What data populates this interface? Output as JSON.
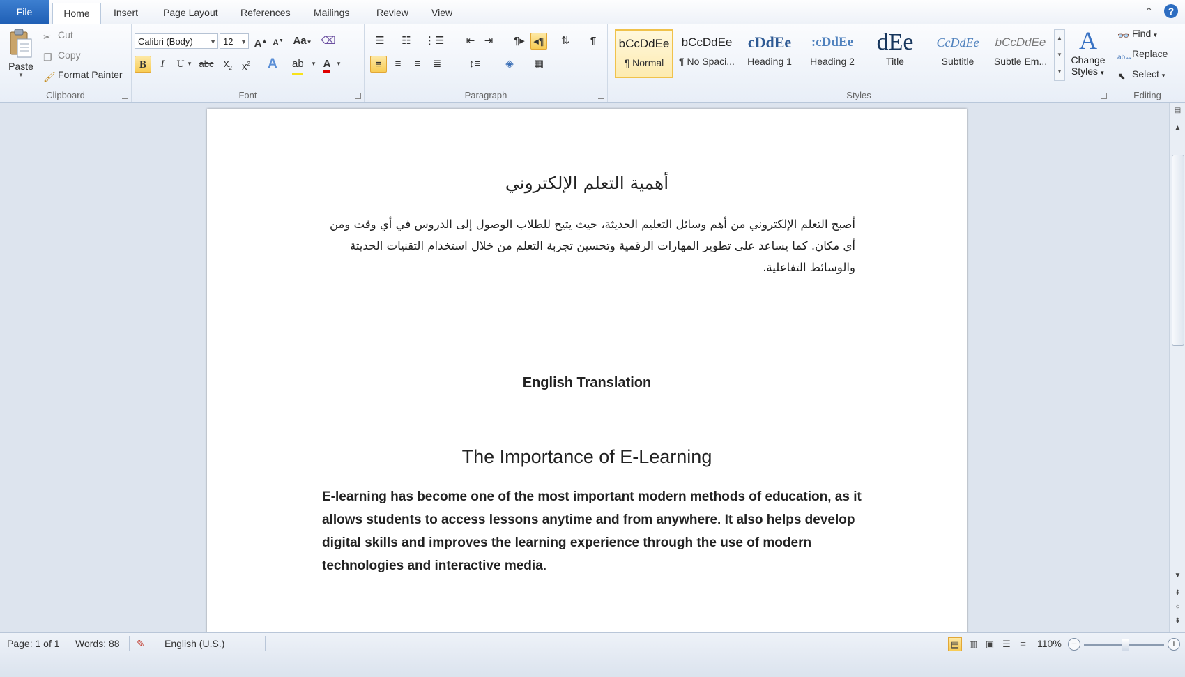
{
  "tabs": {
    "file": "File",
    "home": "Home",
    "insert": "Insert",
    "page_layout": "Page Layout",
    "references": "References",
    "mailings": "Mailings",
    "review": "Review",
    "view": "View"
  },
  "clipboard": {
    "paste": "Paste",
    "cut": "Cut",
    "copy": "Copy",
    "format_painter": "Format Painter",
    "label": "Clipboard"
  },
  "font": {
    "name": "Calibri (Body)",
    "size": "12",
    "bold": "B",
    "italic": "I",
    "underline": "U",
    "strike": "abc",
    "label": "Font"
  },
  "paragraph": {
    "label": "Paragraph"
  },
  "styles": {
    "label": "Styles",
    "items": [
      {
        "preview": "bCcDdEe",
        "name": "¶ Normal"
      },
      {
        "preview": "bCcDdEe",
        "name": "¶ No Spaci..."
      },
      {
        "preview": "cDdEe",
        "name": "Heading 1"
      },
      {
        "preview": ":cDdEe",
        "name": "Heading 2"
      },
      {
        "preview": "dEe",
        "name": "Title"
      },
      {
        "preview": "CcDdEe",
        "name": "Subtitle"
      },
      {
        "preview": "bCcDdEe",
        "name": "Subtle Em..."
      }
    ],
    "change_styles_line1": "Change",
    "change_styles_line2": "Styles"
  },
  "editing": {
    "find": "Find",
    "replace": "Replace",
    "select": "Select",
    "label": "Editing"
  },
  "document": {
    "arabic_title": "أهمية التعلم الإلكتروني",
    "arabic_body": "أصبح التعلم الإلكتروني من أهم وسائل التعليم الحديثة، حيث يتيح للطلاب الوصول إلى الدروس في أي وقت ومن أي مكان. كما يساعد على تطوير المهارات الرقمية وتحسين تجربة التعلم من خلال استخدام التقنيات الحديثة والوسائط التفاعلية.",
    "translation_label": "English Translation",
    "english_title": "The Importance of E-Learning",
    "english_body": "E-learning has become one of the most important modern methods of education, as it allows students to access lessons anytime and from anywhere. It also helps develop digital skills and improves the learning experience through the use of modern technologies and interactive media."
  },
  "status": {
    "page": "Page: 1 of 1",
    "words": "Words: 88",
    "language": "English (U.S.)",
    "zoom": "110%"
  },
  "colors": {
    "file_tab": "#2a6bc2",
    "highlight": "#f8cc55",
    "font_color": "#e00000",
    "doc_background": "#dde4ee"
  }
}
